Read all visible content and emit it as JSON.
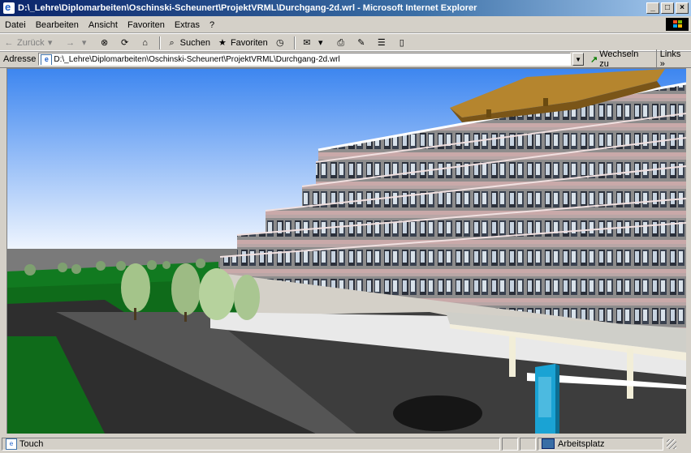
{
  "window": {
    "title": "D:\\_Lehre\\Diplomarbeiten\\Oschinski-Scheunert\\ProjektVRML\\Durchgang-2d.wrl - Microsoft Internet Explorer",
    "minimize": "_",
    "maximize": "□",
    "close": "×"
  },
  "menu": {
    "items": [
      "Datei",
      "Bearbeiten",
      "Ansicht",
      "Favoriten",
      "Extras",
      "?"
    ]
  },
  "toolbar": {
    "back": "Zurück",
    "back_icon": "←",
    "forward_icon": "→",
    "stop_icon": "⊗",
    "refresh_icon": "⟳",
    "home_icon": "⌂",
    "search": "Suchen",
    "search_icon": "⌕",
    "favorites": "Favoriten",
    "favorites_icon": "★",
    "history_icon": "◷",
    "mail_icon": "✉",
    "print_icon": "⎙",
    "edit_icon": "✎",
    "discuss_icon": "☰",
    "messenger_icon": "▯"
  },
  "address": {
    "label": "Adresse",
    "value": "D:\\_Lehre\\Diplomarbeiten\\Oschinski-Scheunert\\ProjektVRML\\Durchgang-2d.wrl",
    "go": "Wechseln zu",
    "links": "Links"
  },
  "status": {
    "text": "Touch",
    "zone": "Arbeitsplatz"
  },
  "colors": {
    "titlebar_start": "#0a246a",
    "titlebar_end": "#a6caf0",
    "chrome": "#d4d0c8",
    "sky_top": "#3d86f0",
    "sky_bottom": "#f5f9ff",
    "grass": "#0f6b1a",
    "road": "#3a3a3a"
  },
  "icons": {
    "ie": "ie-logo-icon",
    "windows": "windows-flag-icon",
    "page": "page-icon",
    "computer": "computer-icon"
  }
}
